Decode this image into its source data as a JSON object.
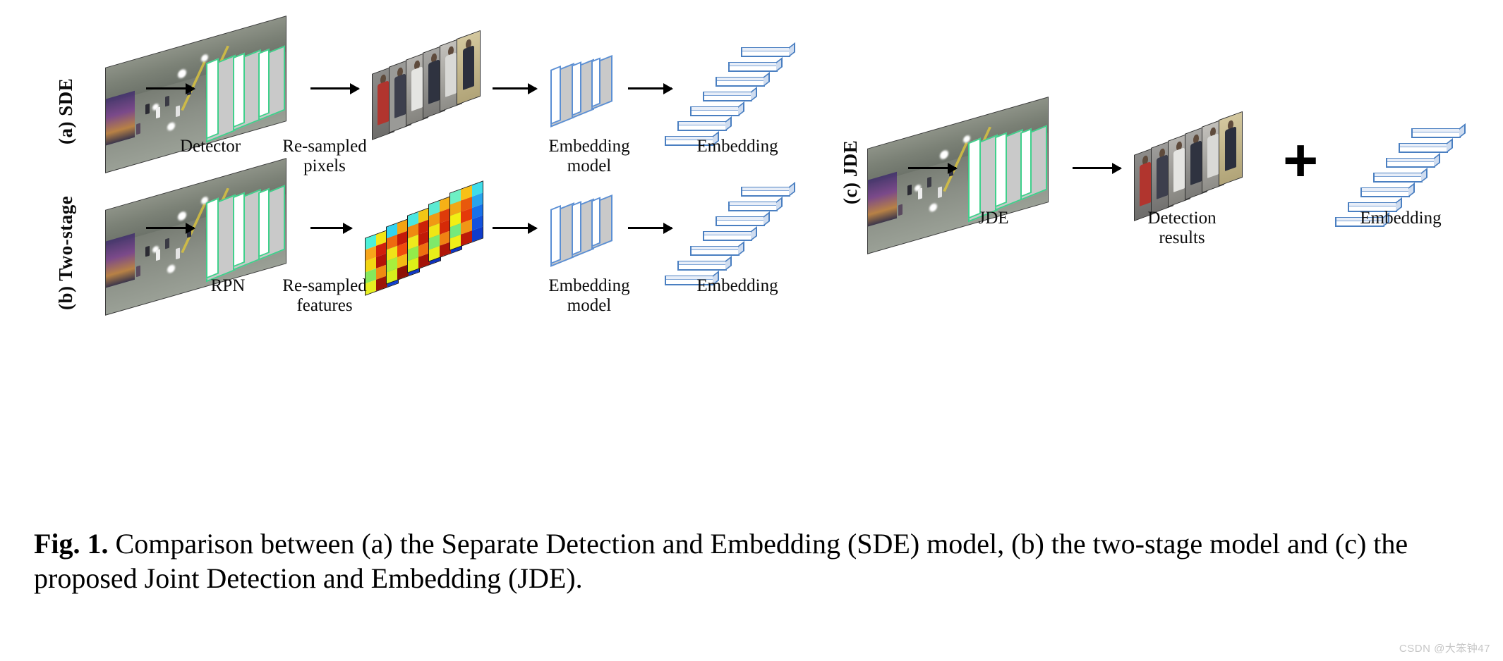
{
  "figure": {
    "id": "Fig. 1.",
    "caption_lead": "Fig. 1.",
    "caption_rest": " Comparison between (a) the Separate Detection and Embedding (SDE) model, (b) the two-stage model and (c) the proposed Joint Detection and Embedding (JDE).",
    "caption_full": "Fig. 1. Comparison between (a) the Separate Detection and Embedding (SDE) model, (b) the two-stage model and (c) the proposed Joint Detection and Embedding (JDE)."
  },
  "rows": {
    "a": {
      "label": "(a) SDE",
      "stages": [
        {
          "name": "input-frame",
          "caption": ""
        },
        {
          "name": "detector",
          "caption": "Detector"
        },
        {
          "name": "re-sampled-pixels",
          "caption": "Re-sampled\npixels"
        },
        {
          "name": "embedding-model",
          "caption": "Embedding\nmodel"
        },
        {
          "name": "embedding",
          "caption": "Embedding"
        }
      ]
    },
    "b": {
      "label": "(b) Two-stage",
      "stages": [
        {
          "name": "input-frame",
          "caption": ""
        },
        {
          "name": "rpn",
          "caption": "RPN"
        },
        {
          "name": "re-sampled-features",
          "caption": "Re-sampled\nfeatures"
        },
        {
          "name": "embedding-model",
          "caption": "Embedding\nmodel"
        },
        {
          "name": "embedding",
          "caption": "Embedding"
        }
      ]
    },
    "c": {
      "label": "(c) JDE",
      "stages": [
        {
          "name": "input-frame",
          "caption": ""
        },
        {
          "name": "jde",
          "caption": "JDE"
        },
        {
          "name": "detection-results",
          "caption": "Detection\nresults"
        },
        {
          "name": "embedding",
          "caption": "Embedding"
        }
      ],
      "operator": "+"
    }
  },
  "colors": {
    "detector_outline": "#3fd08b",
    "detector_fill": "#c9c9c9",
    "embedding_model_outline": "#5b8fd4",
    "embedding_bar_outline": "#4a7fc1",
    "embedding_bar_fill": "#ffffff",
    "arrow": "#000000",
    "background": "#ffffff",
    "watermark": "#c6c6c6"
  },
  "counts": {
    "embedding_bars": 7,
    "conv_slabs": 3,
    "patches_sde": 6,
    "patches_jde": 6,
    "heatmap_planes": 5
  },
  "watermark": {
    "text": "CSDN @大笨钟47"
  }
}
